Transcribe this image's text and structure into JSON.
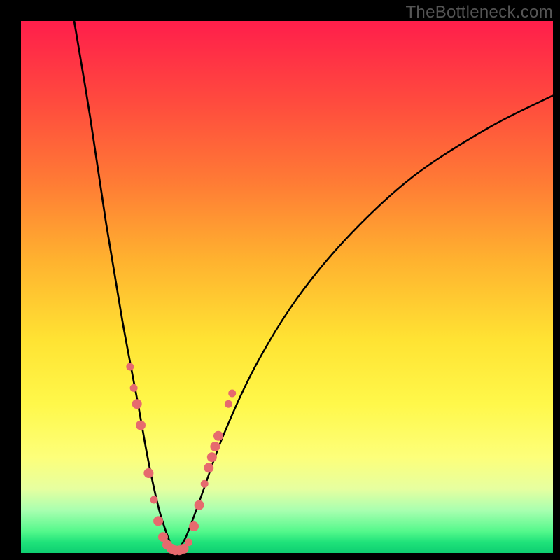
{
  "watermark": "TheBottleneck.com",
  "colors": {
    "dot_fill": "#e66a6e",
    "dot_stroke": "#c94f54",
    "curve": "#000000"
  },
  "chart_data": {
    "type": "line",
    "title": "",
    "xlabel": "",
    "ylabel": "",
    "xlim": [
      0,
      100
    ],
    "ylim": [
      0,
      100
    ],
    "grid": false,
    "curve_left": [
      {
        "x": 10,
        "y": 100
      },
      {
        "x": 13,
        "y": 82
      },
      {
        "x": 16,
        "y": 62
      },
      {
        "x": 19,
        "y": 44
      },
      {
        "x": 22,
        "y": 28
      },
      {
        "x": 24,
        "y": 17
      },
      {
        "x": 26,
        "y": 8
      },
      {
        "x": 28,
        "y": 2
      },
      {
        "x": 29,
        "y": 0
      }
    ],
    "curve_right": [
      {
        "x": 29,
        "y": 0
      },
      {
        "x": 31,
        "y": 3
      },
      {
        "x": 34,
        "y": 11
      },
      {
        "x": 38,
        "y": 22
      },
      {
        "x": 44,
        "y": 35
      },
      {
        "x": 52,
        "y": 48
      },
      {
        "x": 62,
        "y": 60
      },
      {
        "x": 74,
        "y": 71
      },
      {
        "x": 88,
        "y": 80
      },
      {
        "x": 100,
        "y": 86
      }
    ],
    "dots": [
      {
        "x": 20.5,
        "y": 35
      },
      {
        "x": 21.2,
        "y": 31
      },
      {
        "x": 21.8,
        "y": 28
      },
      {
        "x": 22.5,
        "y": 24
      },
      {
        "x": 24.0,
        "y": 15
      },
      {
        "x": 25.0,
        "y": 10
      },
      {
        "x": 25.8,
        "y": 6
      },
      {
        "x": 26.7,
        "y": 3
      },
      {
        "x": 27.5,
        "y": 1.5
      },
      {
        "x": 28.3,
        "y": 0.8
      },
      {
        "x": 29.0,
        "y": 0.5
      },
      {
        "x": 29.8,
        "y": 0.5
      },
      {
        "x": 30.6,
        "y": 0.8
      },
      {
        "x": 31.5,
        "y": 2
      },
      {
        "x": 32.5,
        "y": 5
      },
      {
        "x": 33.5,
        "y": 9
      },
      {
        "x": 34.5,
        "y": 13
      },
      {
        "x": 35.3,
        "y": 16
      },
      {
        "x": 35.9,
        "y": 18
      },
      {
        "x": 36.5,
        "y": 20
      },
      {
        "x": 37.1,
        "y": 22
      },
      {
        "x": 39.0,
        "y": 28
      },
      {
        "x": 39.7,
        "y": 30
      }
    ],
    "dot_radii": [
      5.5,
      5.5,
      7,
      7,
      7,
      5.5,
      7,
      7,
      7,
      7,
      7,
      7,
      7,
      5.5,
      7,
      7,
      5.5,
      7,
      7,
      7,
      7,
      5.5,
      5.5
    ]
  }
}
